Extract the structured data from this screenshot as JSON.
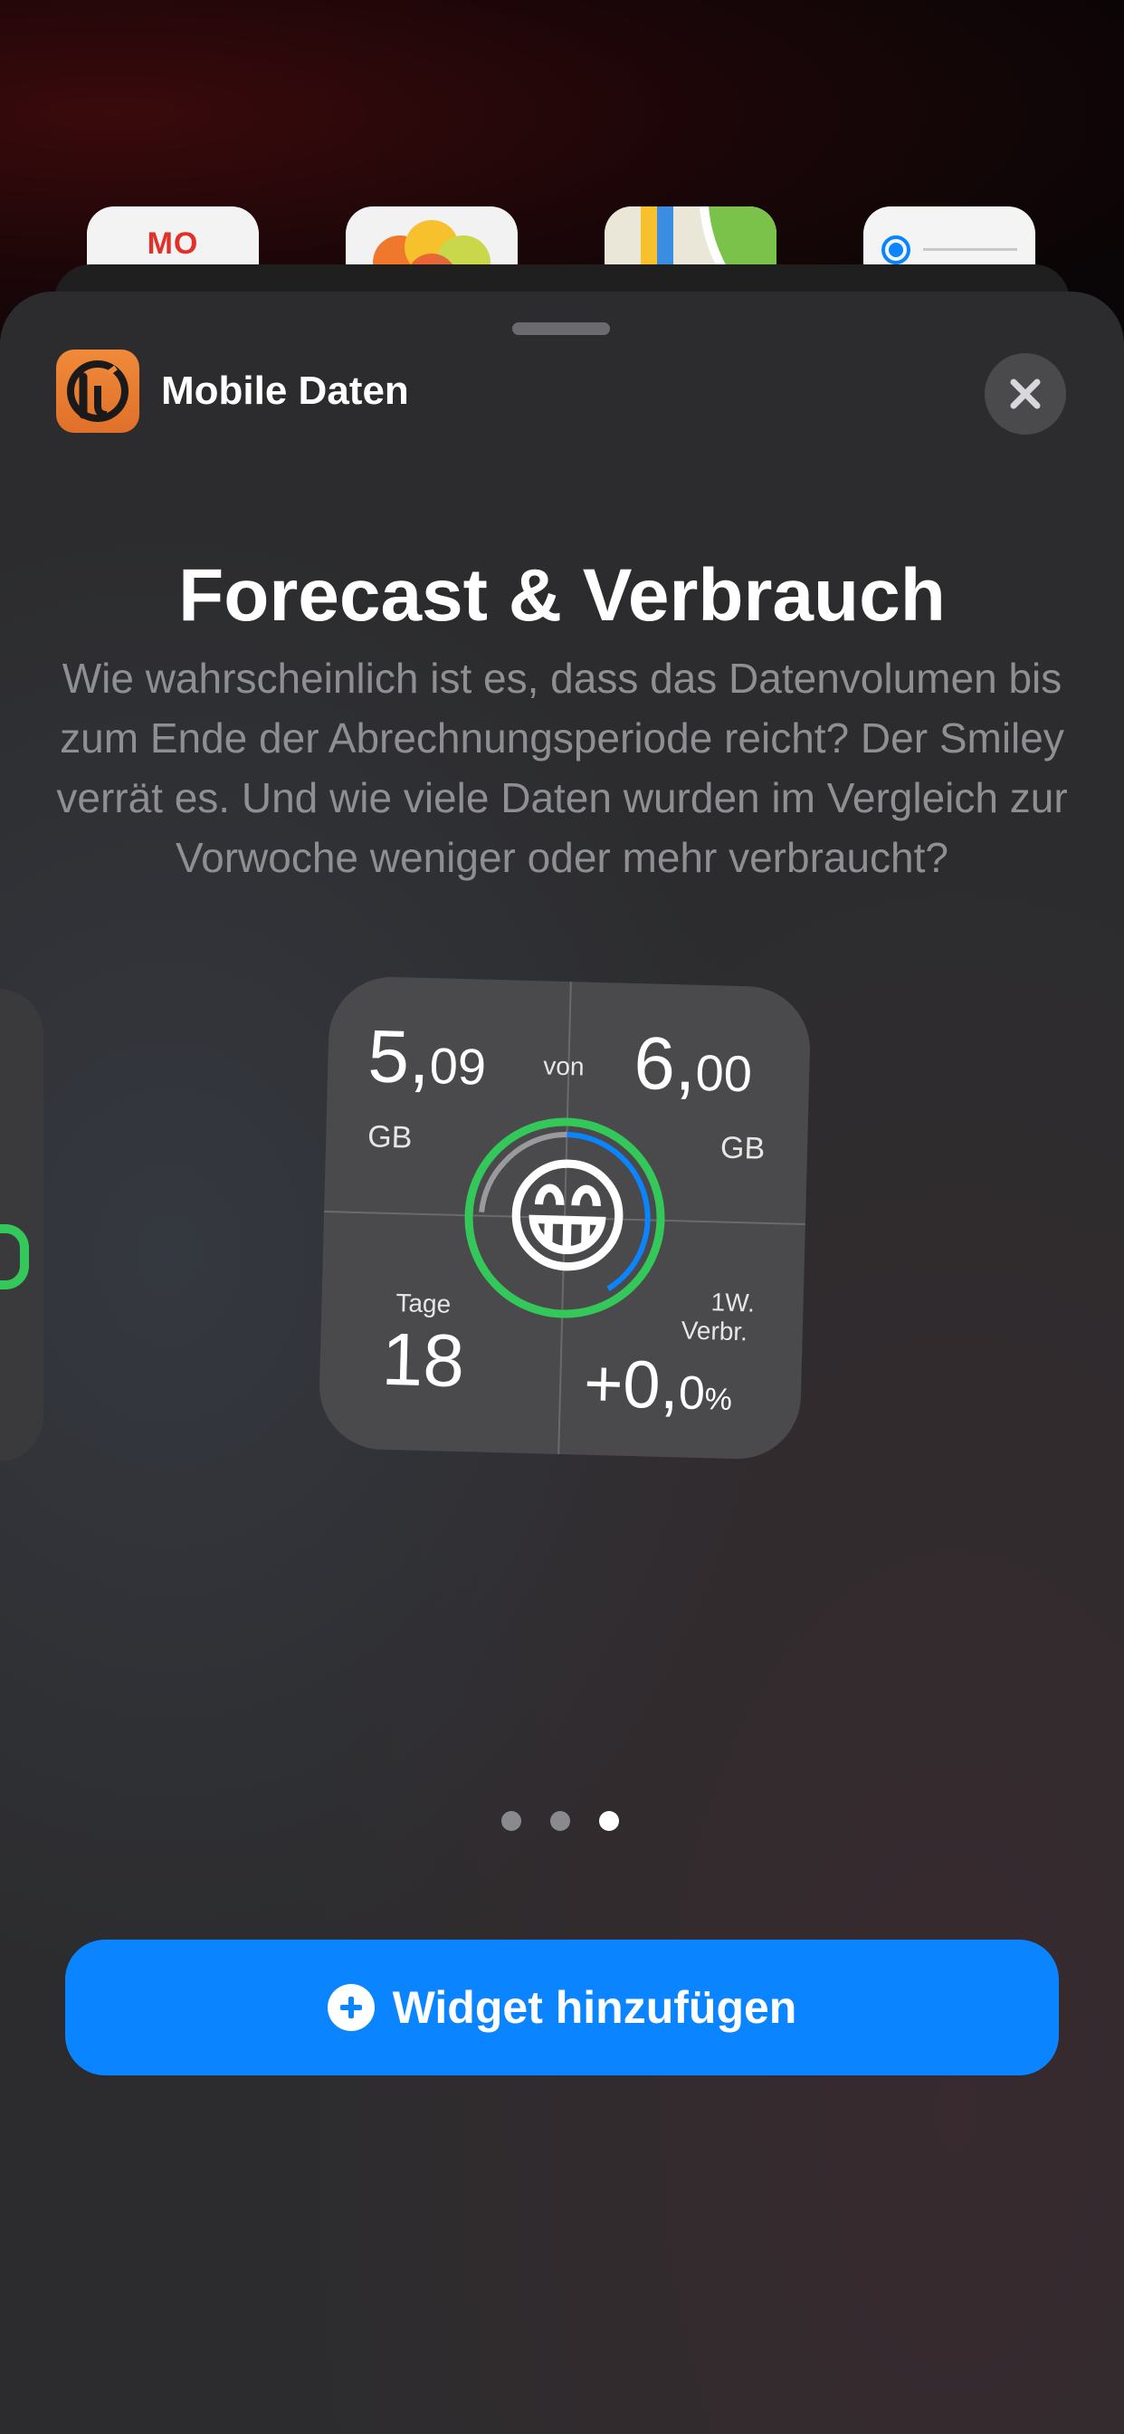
{
  "home_screen": {
    "calendar_label": "MO"
  },
  "header": {
    "app_name": "Mobile Daten",
    "close_icon": "close-icon"
  },
  "widget_info": {
    "title": "Forecast & Verbrauch",
    "description": "Wie wahrscheinlich ist es, dass das Datenvolumen bis zum Ende der Abrechnungsperiode reicht? Der Smiley verrät es. Und wie viele Daten wurden im Vergleich zur Vorwoche weniger oder mehr verbraucht?"
  },
  "widget": {
    "used_int": "5,",
    "used_dec": "09",
    "used_unit": "GB",
    "of_label": "von",
    "total_int": "6,",
    "total_dec": "00",
    "total_unit": "GB",
    "days_label": "Tage",
    "days_value": "18",
    "week_label_1": "1W.",
    "week_label_2": "Verbr.",
    "change_int": "+0,",
    "change_dec": "0",
    "change_unit": "%",
    "smiley": "😁",
    "ring_colors": {
      "outer": "#34c759",
      "inner": "#0a84ff",
      "track": "#8e8e93"
    }
  },
  "pagination": {
    "count": 3,
    "active_index": 2
  },
  "add_button": {
    "label": "Widget hinzufügen",
    "icon": "plus-circle-icon"
  },
  "colors": {
    "accent": "#0a84ff",
    "sheet": "#2c2c2e",
    "app_icon": "#f08a3a"
  }
}
